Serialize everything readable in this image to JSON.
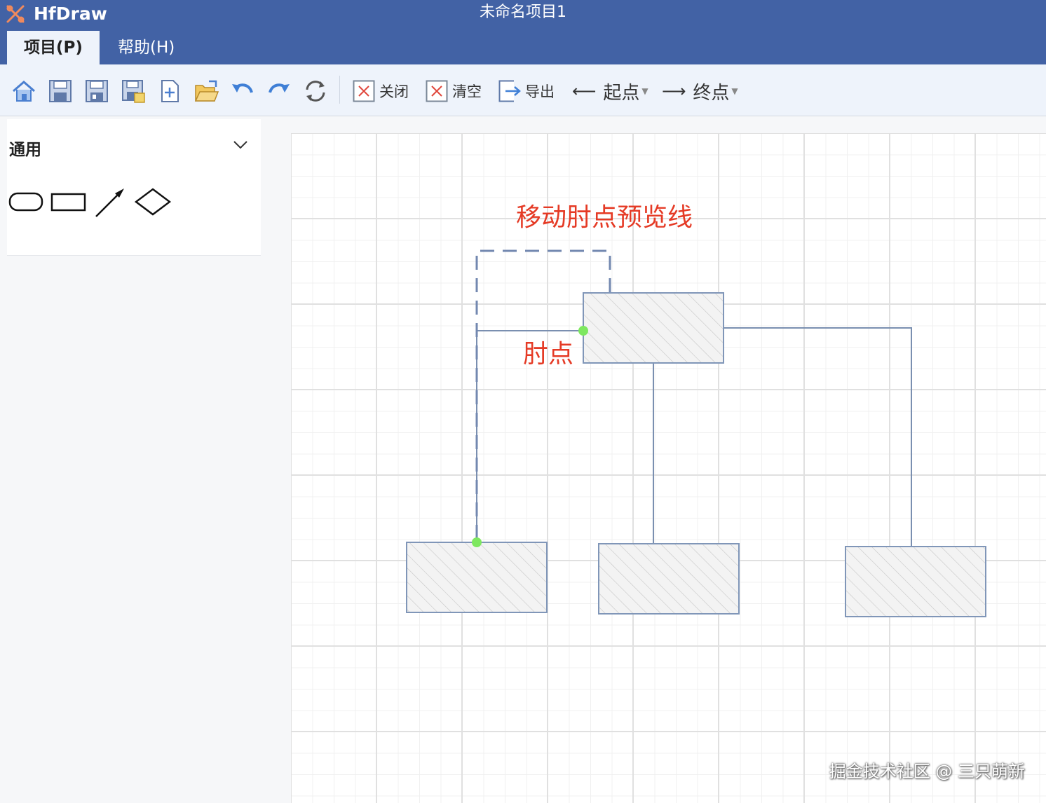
{
  "window": {
    "app_name": "HfDraw",
    "title": "未命名项目1"
  },
  "menu": {
    "tabs": [
      {
        "label": "项目(P)"
      },
      {
        "label": "帮助(H)"
      }
    ]
  },
  "toolbar": {
    "icons": [
      "home-icon",
      "save-icon",
      "save-as-icon",
      "save-image-icon",
      "new-file-icon",
      "open-folder-icon",
      "undo-icon",
      "redo-icon",
      "refresh-icon"
    ],
    "close_label": "关闭",
    "clear_label": "清空",
    "export_label": "导出",
    "start_label": "起点",
    "end_label": "终点"
  },
  "sidebar": {
    "section_title": "通用",
    "shapes": [
      "rounded-rectangle",
      "rectangle",
      "arrow",
      "diamond"
    ]
  },
  "canvas": {
    "annotation_preview": "移动肘点预览线",
    "annotation_elbow": "肘点",
    "colors": {
      "annotation": "#e53a25",
      "node_border": "#8096b8",
      "connector": "#7a8fb0",
      "handle": "#7ee860",
      "titlebar": "#4262a5"
    }
  },
  "watermark": "掘金技术社区 @ 三只萌新"
}
